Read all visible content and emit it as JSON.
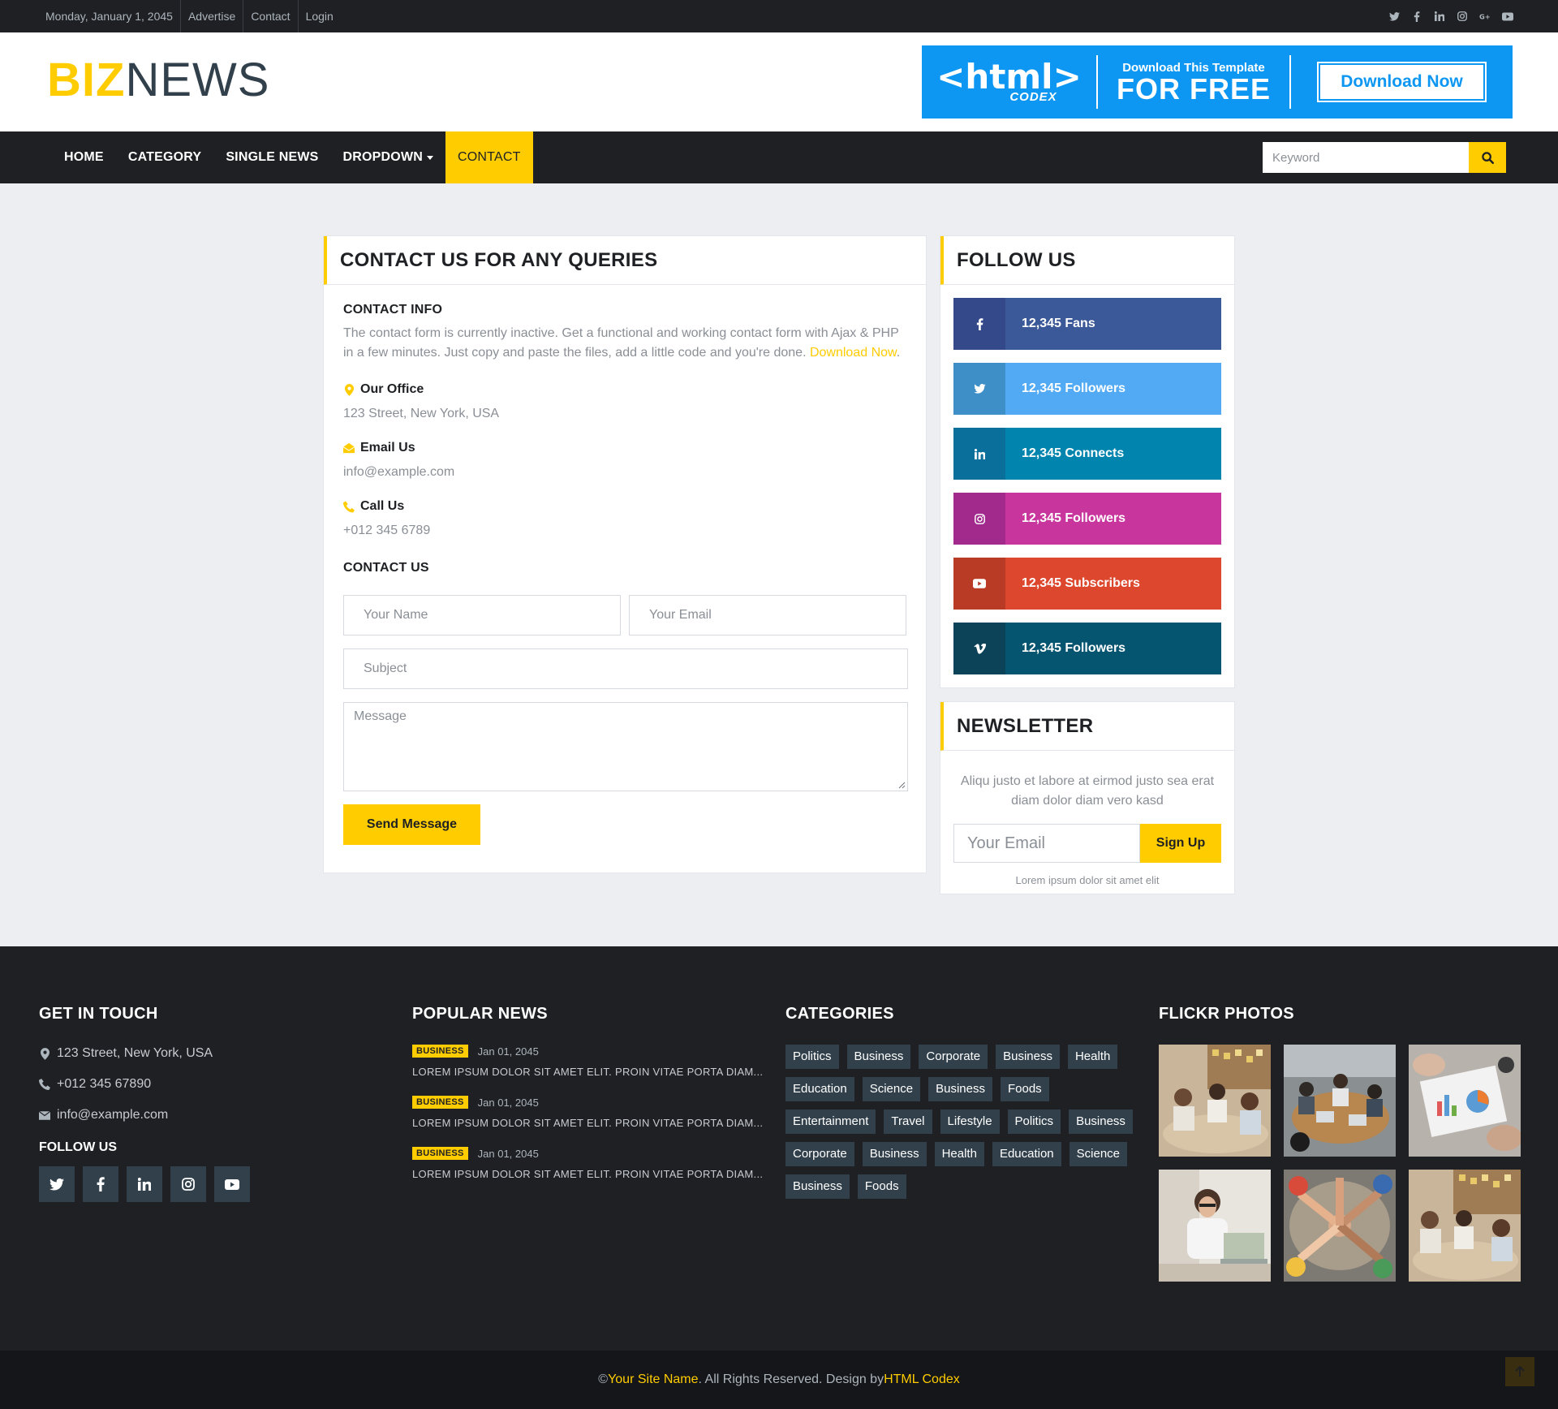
{
  "topbar": {
    "date": "Monday, January 1, 2045",
    "links": [
      "Advertise",
      "Contact",
      "Login"
    ],
    "social_icons": [
      "twitter-icon",
      "facebook-icon",
      "linkedin-icon",
      "instagram-icon",
      "google-plus-icon",
      "youtube-icon"
    ]
  },
  "header": {
    "logo_part1": "BIZ",
    "logo_part2": "NEWS",
    "banner": {
      "logo_text": "<html>",
      "logo_sub": "CODEX",
      "small": "Download This Template",
      "big": "FOR FREE",
      "button": "Download Now"
    }
  },
  "nav": {
    "items": [
      "HOME",
      "CATEGORY",
      "SINGLE NEWS",
      "DROPDOWN",
      "CONTACT"
    ],
    "active": "CONTACT",
    "search_placeholder": "Keyword"
  },
  "contact": {
    "title": "CONTACT US FOR ANY QUERIES",
    "info_title": "CONTACT INFO",
    "description": "The contact form is currently inactive. Get a functional and working contact form with Ajax & PHP in a few minutes. Just copy and paste the files, add a little code and you're done.",
    "download_link": "Download Now",
    "desc_end": ".",
    "office_label": "Our Office",
    "office_value": "123 Street, New York, USA",
    "email_label": "Email Us",
    "email_value": "info@example.com",
    "call_label": "Call Us",
    "call_value": "+012 345 6789",
    "form_title": "CONTACT US",
    "name_placeholder": "Your Name",
    "email_placeholder": "Your Email",
    "subject_placeholder": "Subject",
    "message_placeholder": "Message",
    "send_button": "Send Message"
  },
  "follow": {
    "title": "FOLLOW US",
    "items": [
      {
        "icon": "facebook-icon",
        "text": "12,345 Fans",
        "dark": "#34498a",
        "light": "#3b5998"
      },
      {
        "icon": "twitter-icon",
        "text": "12,345 Followers",
        "dark": "#3e8ec8",
        "light": "#52aaf4"
      },
      {
        "icon": "linkedin-icon",
        "text": "12,345 Connects",
        "dark": "#0a6f9a",
        "light": "#0185ae"
      },
      {
        "icon": "instagram-icon",
        "text": "12,345 Followers",
        "dark": "#a22a8c",
        "light": "#c8359d"
      },
      {
        "icon": "youtube-icon",
        "text": "12,345 Subscribers",
        "dark": "#b93a25",
        "light": "#dc472e"
      },
      {
        "icon": "vimeo-icon",
        "text": "12,345 Followers",
        "dark": "#0c4358",
        "light": "#055570"
      }
    ]
  },
  "newsletter": {
    "title": "NEWSLETTER",
    "text": "Aliqu justo et labore at eirmod justo sea erat diam dolor diam vero kasd",
    "email_placeholder": "Your Email",
    "button": "Sign Up",
    "small": "Lorem ipsum dolor sit amet elit"
  },
  "footer": {
    "get_in_touch": {
      "title": "GET IN TOUCH",
      "address": "123 Street, New York, USA",
      "phone": "+012 345 67890",
      "email": "info@example.com",
      "follow_title": "FOLLOW US",
      "social_icons": [
        "twitter-icon",
        "facebook-icon",
        "linkedin-icon",
        "instagram-icon",
        "youtube-icon"
      ]
    },
    "popular_news": {
      "title": "POPULAR NEWS",
      "items": [
        {
          "badge": "BUSINESS",
          "date": "Jan 01, 2045",
          "title": "LOREM IPSUM DOLOR SIT AMET ELIT. PROIN VITAE PORTA DIAM..."
        },
        {
          "badge": "BUSINESS",
          "date": "Jan 01, 2045",
          "title": "LOREM IPSUM DOLOR SIT AMET ELIT. PROIN VITAE PORTA DIAM..."
        },
        {
          "badge": "BUSINESS",
          "date": "Jan 01, 2045",
          "title": "LOREM IPSUM DOLOR SIT AMET ELIT. PROIN VITAE PORTA DIAM..."
        }
      ]
    },
    "categories": {
      "title": "CATEGORIES",
      "tags": [
        "Politics",
        "Business",
        "Corporate",
        "Business",
        "Health",
        "Education",
        "Science",
        "Business",
        "Foods",
        "Entertainment",
        "Travel",
        "Lifestyle",
        "Politics",
        "Business",
        "Corporate",
        "Business",
        "Health",
        "Education",
        "Science",
        "Business",
        "Foods"
      ]
    },
    "flickr": {
      "title": "FLICKR PHOTOS",
      "photos": [
        "team-meeting-photo",
        "office-meeting-photo",
        "documents-charts-photo",
        "woman-laptop-photo",
        "team-hands-photo",
        "team-meeting-photo-2"
      ]
    },
    "copyright": {
      "prefix": "© ",
      "site_name": "Your Site Name",
      "middle": ". All Rights Reserved. Design by ",
      "designer": "HTML Codex"
    }
  },
  "colors": {
    "accent": "#ffcc00",
    "dark": "#1e2024",
    "tag_bg": "#31404b"
  }
}
